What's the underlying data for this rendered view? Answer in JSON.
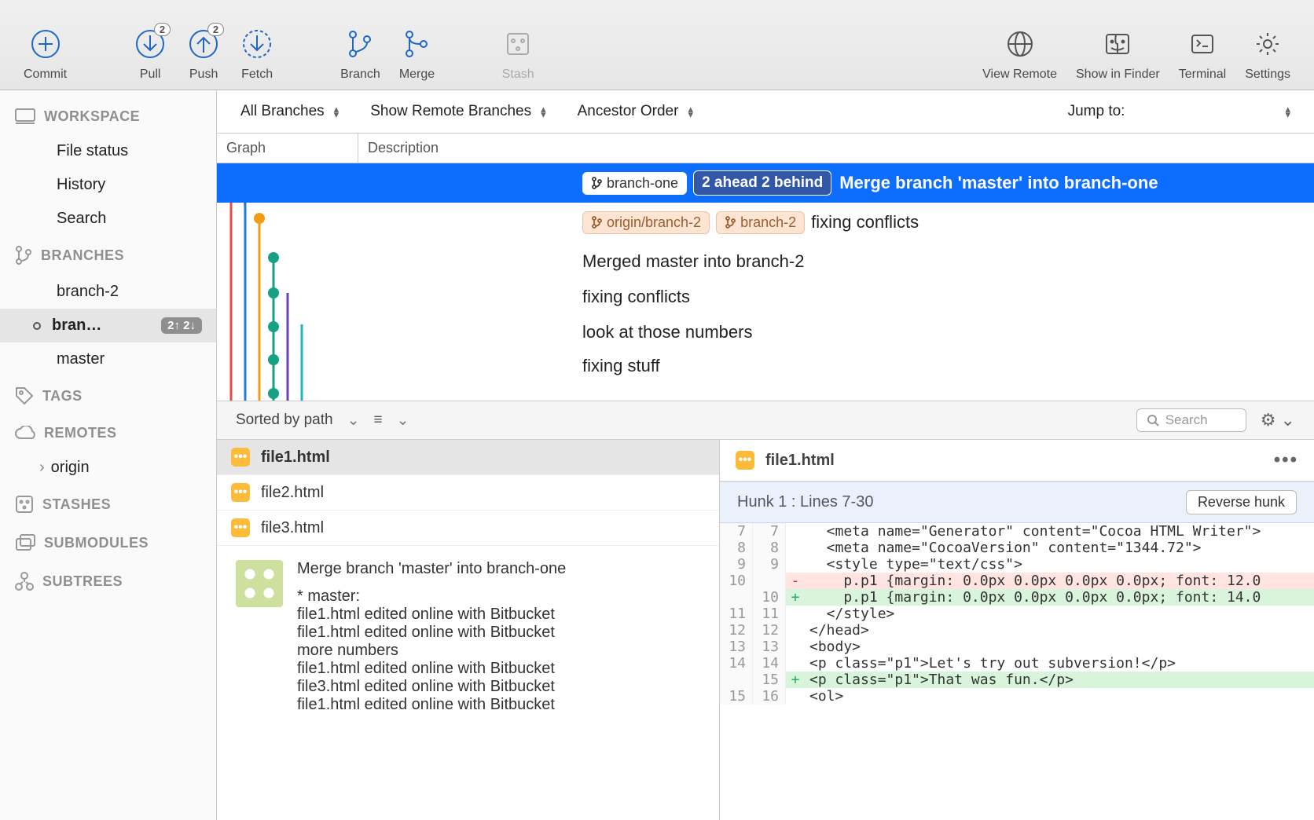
{
  "toolbar": {
    "commit": "Commit",
    "pull": "Pull",
    "pull_badge": "2",
    "push": "Push",
    "push_badge": "2",
    "fetch": "Fetch",
    "branch": "Branch",
    "merge": "Merge",
    "stash": "Stash",
    "view_remote": "View Remote",
    "show_in_finder": "Show in Finder",
    "terminal": "Terminal",
    "settings": "Settings"
  },
  "sidebar": {
    "workspace": {
      "label": "WORKSPACE",
      "file_status": "File status",
      "history": "History",
      "search": "Search"
    },
    "branches": {
      "label": "BRANCHES",
      "items": [
        {
          "name": "branch-2",
          "sel": false
        },
        {
          "name": "bran…",
          "sel": true,
          "pill": "2↑ 2↓"
        },
        {
          "name": "master",
          "sel": false
        }
      ]
    },
    "tags": "TAGS",
    "remotes": {
      "label": "REMOTES",
      "origin": "origin"
    },
    "stashes": "STASHES",
    "submodules": "SUBMODULES",
    "subtrees": "SUBTREES"
  },
  "filterbar": {
    "all_branches": "All Branches",
    "show_remote": "Show Remote Branches",
    "ancestor": "Ancestor Order",
    "jump": "Jump to:"
  },
  "cols": {
    "graph": "Graph",
    "description": "Description"
  },
  "commits": [
    {
      "sel": true,
      "tags": [
        "branch-one"
      ],
      "status": "2 ahead 2 behind",
      "msg": "Merge branch 'master' into branch-one"
    },
    {
      "tags": [
        "origin/branch-2",
        "branch-2"
      ],
      "msg": "fixing conflicts"
    },
    {
      "msg": "Merged master into branch-2"
    },
    {
      "msg": "fixing conflicts"
    },
    {
      "msg": "look at those numbers"
    },
    {
      "msg": "fixing stuff"
    }
  ],
  "detail_bar": {
    "sort": "Sorted by path",
    "search_ph": "Search"
  },
  "files": [
    "file1.html",
    "file2.html",
    "file3.html"
  ],
  "commit_info": {
    "title": "Merge branch 'master' into branch-one",
    "body": "* master:\nfile1.html edited online with Bitbucket\nfile1.html edited online with Bitbucket\nmore numbers\nfile1.html edited online with Bitbucket\nfile3.html edited online with Bitbucket\nfile1.html edited online with Bitbucket"
  },
  "diff": {
    "file": "file1.html",
    "hunk": "Hunk 1 : Lines 7-30",
    "reverse": "Reverse hunk",
    "lines": [
      {
        "a": "7",
        "b": "7",
        "t": "  <meta name=\"Generator\" content=\"Cocoa HTML Writer\">"
      },
      {
        "a": "8",
        "b": "8",
        "t": "  <meta name=\"CocoaVersion\" content=\"1344.72\">"
      },
      {
        "a": "9",
        "b": "9",
        "t": "  <style type=\"text/css\">"
      },
      {
        "a": "10",
        "b": "",
        "k": "del",
        "t": "    p.p1 {margin: 0.0px 0.0px 0.0px 0.0px; font: 12.0"
      },
      {
        "a": "",
        "b": "10",
        "k": "add",
        "t": "    p.p1 {margin: 0.0px 0.0px 0.0px 0.0px; font: 14.0"
      },
      {
        "a": "11",
        "b": "11",
        "t": "  </style>"
      },
      {
        "a": "12",
        "b": "12",
        "t": "</head>"
      },
      {
        "a": "13",
        "b": "13",
        "t": "<body>"
      },
      {
        "a": "14",
        "b": "14",
        "t": "<p class=\"p1\">Let's try out subversion!</p>"
      },
      {
        "a": "",
        "b": "15",
        "k": "add",
        "t": "<p class=\"p1\">That was fun.</p>"
      },
      {
        "a": "15",
        "b": "16",
        "t": "<ol>"
      }
    ]
  }
}
